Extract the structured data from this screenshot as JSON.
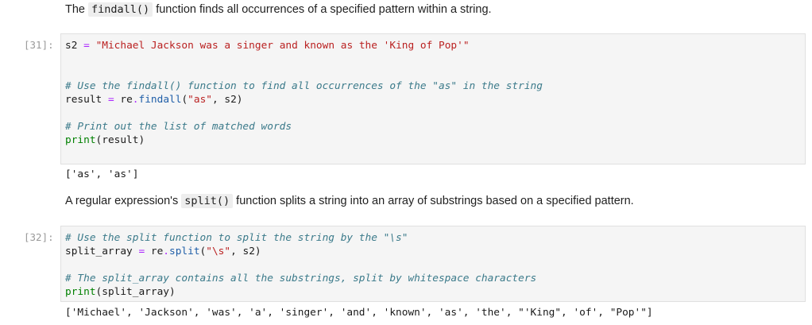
{
  "markdown": {
    "findall_intro": {
      "pre": "The ",
      "code": "findall()",
      "post": " function finds all occurrences of a specified pattern within a string."
    },
    "split_intro": {
      "pre": "A regular expression's ",
      "code": "split()",
      "post": " function splits a string into an array of substrings based on a specified pattern."
    }
  },
  "cells": [
    {
      "prompt": "[31]:",
      "lines": [
        {
          "tokens": [
            [
              "",
              "s2 "
            ],
            [
              "op",
              "="
            ],
            [
              "",
              " "
            ],
            [
              "st",
              "\"Michael Jackson was a singer and known as the 'King of Pop'\""
            ]
          ]
        },
        {
          "tokens": []
        },
        {
          "tokens": []
        },
        {
          "tokens": [
            [
              "cm",
              "# Use the findall() function to find all occurrences of the \"as\" in the string"
            ]
          ]
        },
        {
          "tokens": [
            [
              "",
              "result "
            ],
            [
              "op",
              "="
            ],
            [
              "",
              " re"
            ],
            [
              "op",
              "."
            ],
            [
              "at",
              "findall"
            ],
            [
              "",
              "("
            ],
            [
              "st",
              "\"as\""
            ],
            [
              "",
              ", s2)"
            ]
          ]
        },
        {
          "tokens": []
        },
        {
          "tokens": [
            [
              "cm",
              "# Print out the list of matched words"
            ]
          ]
        },
        {
          "tokens": [
            [
              "kw",
              "print"
            ],
            [
              "",
              "(result)"
            ]
          ]
        }
      ],
      "output": "['as', 'as']"
    },
    {
      "prompt": "[32]:",
      "lines": [
        {
          "tokens": [
            [
              "cm",
              "# Use the split function to split the string by the \"\\s\""
            ]
          ]
        },
        {
          "tokens": [
            [
              "",
              "split_array "
            ],
            [
              "op",
              "="
            ],
            [
              "",
              " re"
            ],
            [
              "op",
              "."
            ],
            [
              "at",
              "split"
            ],
            [
              "",
              "("
            ],
            [
              "st",
              "\"\\s\""
            ],
            [
              "",
              ", s2)"
            ]
          ]
        },
        {
          "tokens": []
        },
        {
          "tokens": [
            [
              "cm",
              "# The split_array contains all the substrings, split by whitespace characters"
            ]
          ]
        },
        {
          "tokens": [
            [
              "kw",
              "print"
            ],
            [
              "",
              "(split_array)"
            ]
          ]
        }
      ],
      "output": "['Michael', 'Jackson', 'was', 'a', 'singer', 'and', 'known', 'as', 'the', \"'King\", 'of', \"Pop'\"]"
    }
  ]
}
